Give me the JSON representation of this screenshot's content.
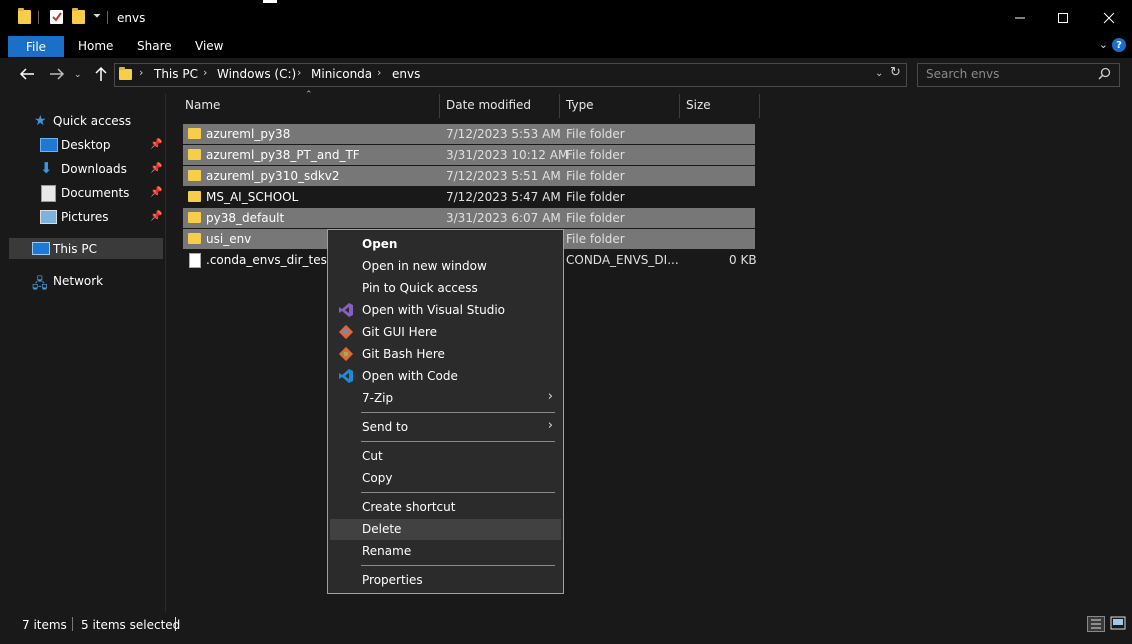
{
  "window": {
    "title": "envs",
    "controls": [
      "minimize-icon",
      "maximize-icon",
      "close-icon"
    ]
  },
  "ribbon": {
    "tabs": [
      "File",
      "Home",
      "Share",
      "View"
    ],
    "help": "?"
  },
  "address": {
    "breadcrumbs": [
      "This PC",
      "Windows (C:)",
      "Miniconda",
      "envs"
    ],
    "search_placeholder": "Search envs"
  },
  "nav": {
    "quick_access": "Quick access",
    "pinned": [
      "Desktop",
      "Downloads",
      "Documents",
      "Pictures"
    ],
    "this_pc": "This PC",
    "network": "Network"
  },
  "columns": [
    "Name",
    "Date modified",
    "Type",
    "Size"
  ],
  "files": [
    {
      "name": "azureml_py38",
      "date": "7/12/2023 5:53 AM",
      "type": "File folder",
      "size": "",
      "selected": true,
      "kind": "folder"
    },
    {
      "name": "azureml_py38_PT_and_TF",
      "date": "3/31/2023 10:12 AM",
      "type": "File folder",
      "size": "",
      "selected": true,
      "kind": "folder"
    },
    {
      "name": "azureml_py310_sdkv2",
      "date": "7/12/2023 5:51 AM",
      "type": "File folder",
      "size": "",
      "selected": true,
      "kind": "folder"
    },
    {
      "name": "MS_AI_SCHOOL",
      "date": "7/12/2023 5:47 AM",
      "type": "File folder",
      "size": "",
      "selected": false,
      "kind": "folder"
    },
    {
      "name": "py38_default",
      "date": "3/31/2023 6:07 AM",
      "type": "File folder",
      "size": "",
      "selected": true,
      "kind": "folder"
    },
    {
      "name": "usi_env",
      "date": "",
      "type": "File folder",
      "size": "",
      "selected": true,
      "kind": "folder"
    },
    {
      "name": ".conda_envs_dir_test",
      "date": "",
      "type": "CONDA_ENVS_DI...",
      "size": "0 KB",
      "selected": false,
      "kind": "file"
    }
  ],
  "context_menu": {
    "open": "Open",
    "open_new_window": "Open in new window",
    "pin_quick_access": "Pin to Quick access",
    "open_visual_studio": "Open with Visual Studio",
    "git_gui": "Git GUI Here",
    "git_bash": "Git Bash Here",
    "open_code": "Open with Code",
    "seven_zip": "7-Zip",
    "send_to": "Send to",
    "cut": "Cut",
    "copy": "Copy",
    "create_shortcut": "Create shortcut",
    "delete": "Delete",
    "rename": "Rename",
    "properties": "Properties"
  },
  "status": {
    "items": "7 items",
    "selected": "5 items selected"
  },
  "colors": {
    "accent": "#1a6fc9",
    "folder": "#f7cd4a",
    "selection": "#777777",
    "background": "#191919"
  }
}
